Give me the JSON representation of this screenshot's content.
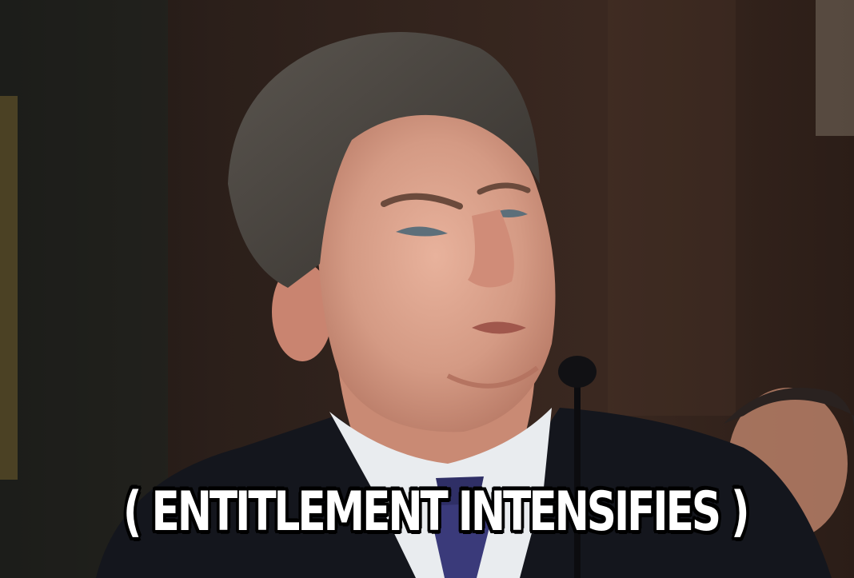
{
  "meme": {
    "caption": "( ENTITLEMENT INTENSIFIES )"
  },
  "colors": {
    "background": "#2a1c17",
    "suit": "#14161d",
    "shirt": "#e9ecef",
    "tie": "#3a3a7a",
    "skin": "#d9a08a",
    "hair": "#4a4540",
    "caption_fill": "#ffffff",
    "caption_stroke": "#000000"
  }
}
